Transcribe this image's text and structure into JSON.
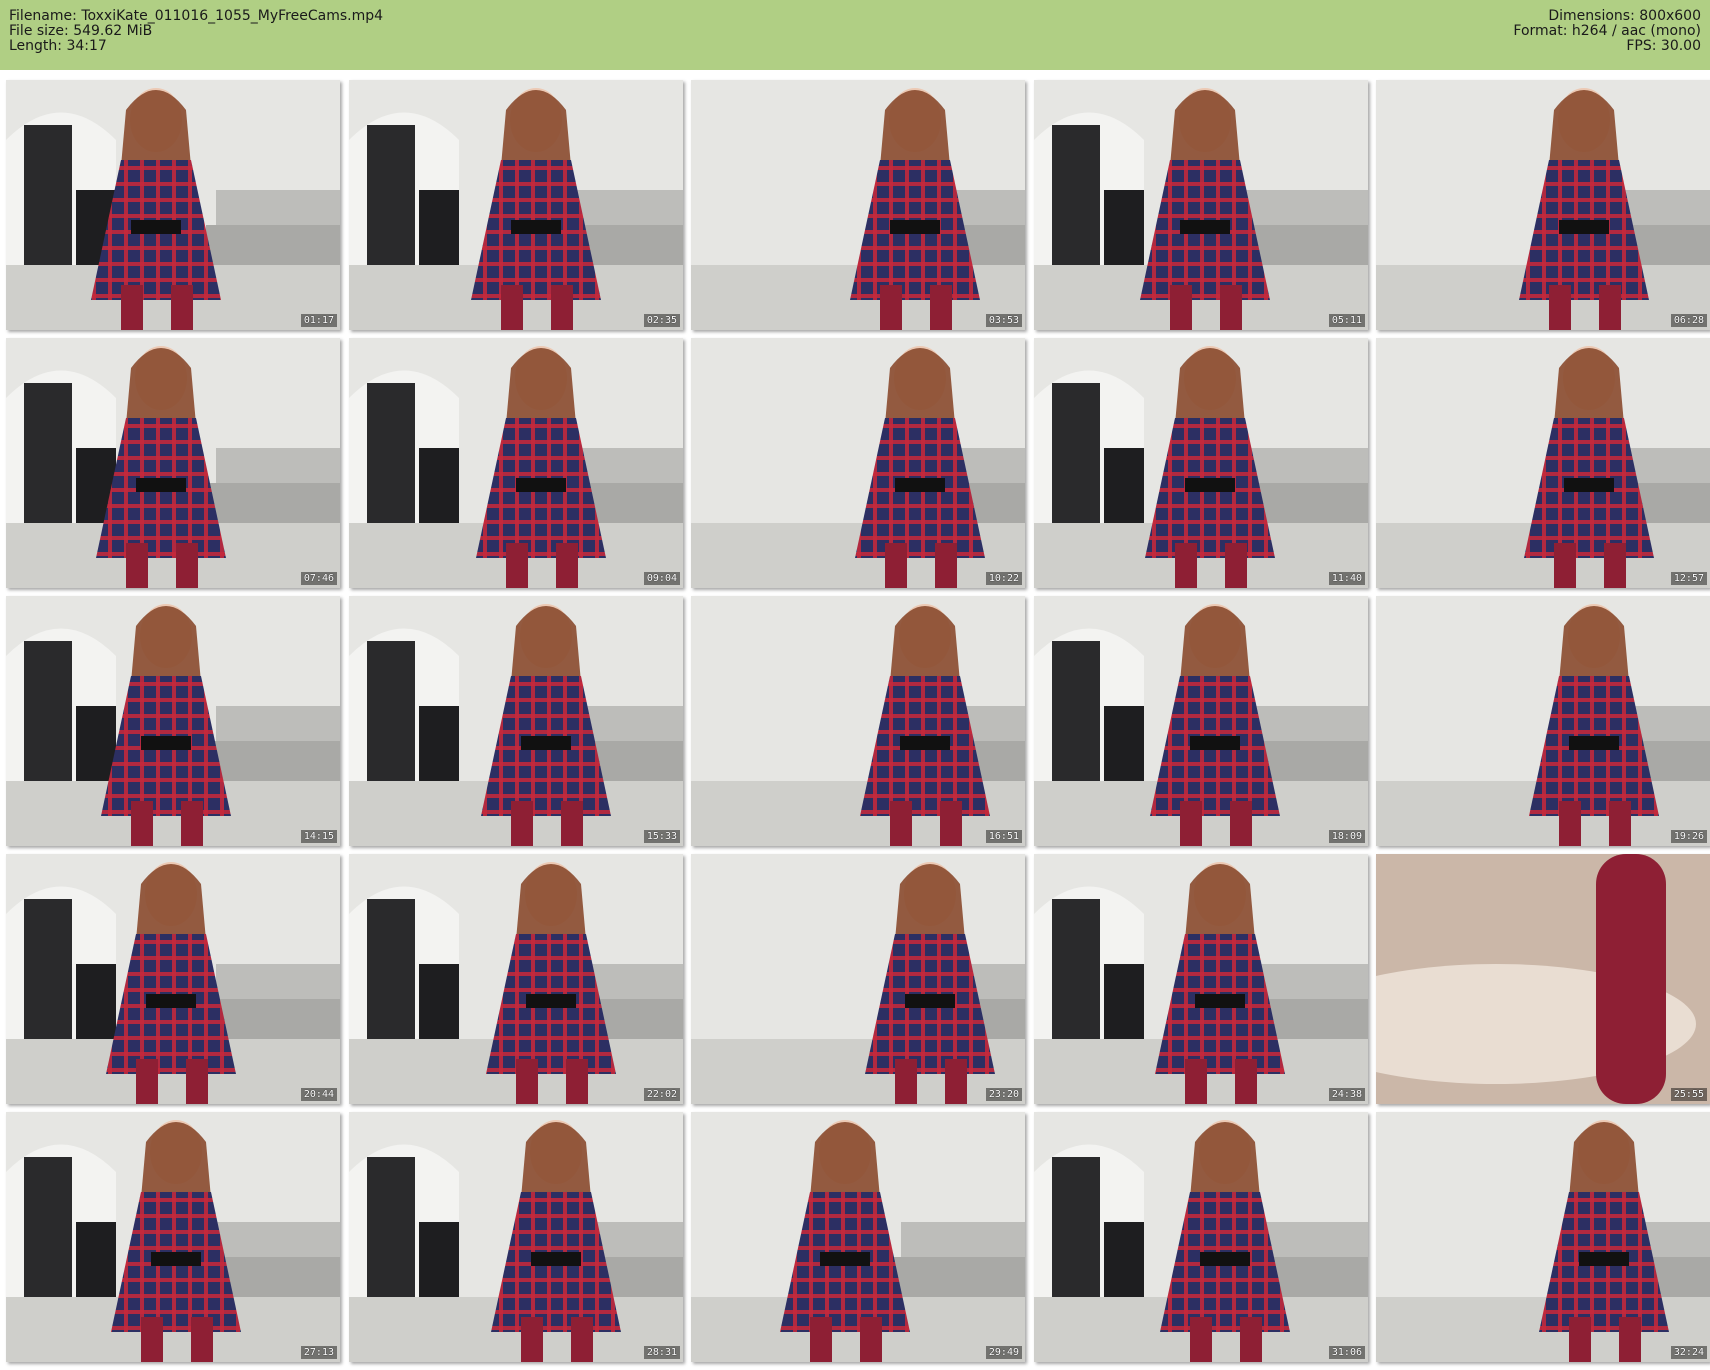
{
  "info": {
    "filename_label": "Filename:",
    "filename": "ToxxiKate_011016_1055_MyFreeCams.mp4",
    "filesize_label": "File size:",
    "filesize": "549.62 MiB",
    "length_label": "Length:",
    "length": "34:17",
    "dimensions_label": "Dimensions:",
    "dimensions": "800x600",
    "format_label": "Format:",
    "format": "h264 / aac (mono)",
    "fps_label": "FPS:",
    "fps": "30.00"
  },
  "thumbnails": [
    {
      "timestamp": "01:17"
    },
    {
      "timestamp": "02:35"
    },
    {
      "timestamp": "03:53"
    },
    {
      "timestamp": "05:11"
    },
    {
      "timestamp": "06:28"
    },
    {
      "timestamp": "07:46"
    },
    {
      "timestamp": "09:04"
    },
    {
      "timestamp": "10:22"
    },
    {
      "timestamp": "11:40"
    },
    {
      "timestamp": "12:57"
    },
    {
      "timestamp": "14:15"
    },
    {
      "timestamp": "15:33"
    },
    {
      "timestamp": "16:51"
    },
    {
      "timestamp": "18:09"
    },
    {
      "timestamp": "19:26"
    },
    {
      "timestamp": "20:44"
    },
    {
      "timestamp": "22:02"
    },
    {
      "timestamp": "23:20"
    },
    {
      "timestamp": "24:38"
    },
    {
      "timestamp": "25:55"
    },
    {
      "timestamp": "27:13"
    },
    {
      "timestamp": "28:31"
    },
    {
      "timestamp": "29:49"
    },
    {
      "timestamp": "31:06"
    },
    {
      "timestamp": "32:24"
    }
  ],
  "colors": {
    "header_bg": "#b0cf84",
    "dress_navy": "#2c2f63",
    "dress_red": "#c8283a",
    "stockings": "#8e1f34",
    "hair": "#8a4a2e",
    "wall": "#e6e6e3",
    "door": "#2a2a2c"
  }
}
